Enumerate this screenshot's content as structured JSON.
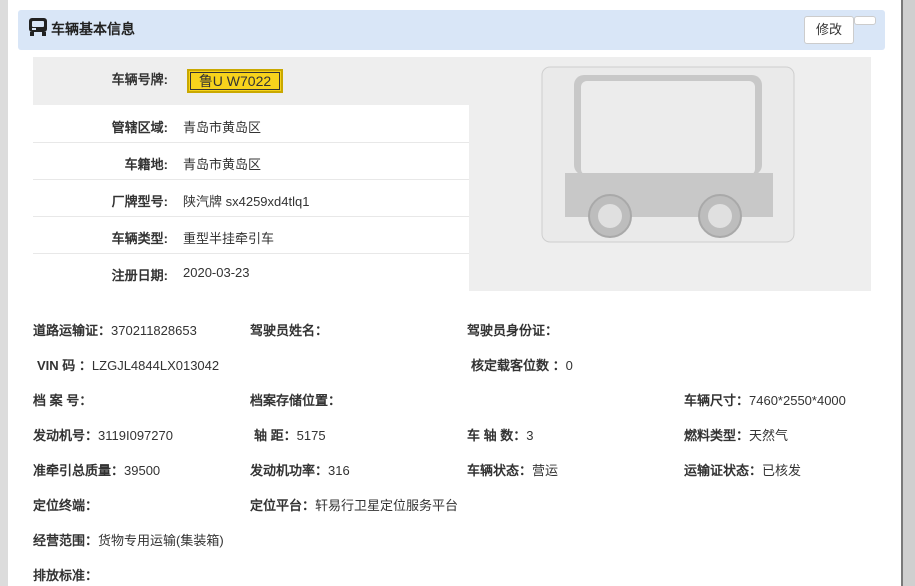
{
  "header": {
    "title": "车辆基本信息",
    "edit_button": "修改",
    "icon": "vehicle-icon"
  },
  "plate": {
    "label": "车辆号牌:",
    "value": "鲁U W7022",
    "color": "#f7d31c"
  },
  "basic_rows": [
    {
      "label": "管辖区域:",
      "value": "青岛市黄岛区"
    },
    {
      "label": "车籍地:",
      "value": "青岛市黄岛区"
    },
    {
      "label": "厂牌型号:",
      "value": "陕汽牌 sx4259xd4tlq1"
    },
    {
      "label": "车辆类型:",
      "value": "重型半挂牵引车"
    },
    {
      "label": "注册日期:",
      "value": "2020-03-23"
    }
  ],
  "details": {
    "transport_cert": {
      "label": "道路运输证：",
      "value": "370211828653"
    },
    "driver_name": {
      "label": "驾驶员姓名：",
      "value": ""
    },
    "driver_id": {
      "label": "驾驶员身份证：",
      "value": ""
    },
    "vin": {
      "label": "VIN 码 ：",
      "value": "LZGJL4844LX013042"
    },
    "seats": {
      "label": "核定载客位数 ：",
      "value": "0"
    },
    "archive_no": {
      "label": "档 案 号：",
      "value": ""
    },
    "archive_loc": {
      "label": "档案存储位置：",
      "value": ""
    },
    "size": {
      "label": "车辆尺寸：",
      "value": "7460*2550*4000"
    },
    "engine_no": {
      "label": "发动机号：",
      "value": "3119I097270"
    },
    "wheelbase": {
      "label": "轴 距：",
      "value": "5175"
    },
    "axles": {
      "label": "车 轴 数：",
      "value": "3"
    },
    "fuel": {
      "label": "燃料类型：",
      "value": "天然气"
    },
    "towing_mass": {
      "label": "准牵引总质量：",
      "value": "39500"
    },
    "engine_power": {
      "label": "发动机功率：",
      "value": "316"
    },
    "vehicle_status": {
      "label": "车辆状态：",
      "value": "营运"
    },
    "transport_status": {
      "label": "运输证状态：",
      "value": "已核发"
    },
    "terminal": {
      "label": "定位终端：",
      "value": ""
    },
    "platform": {
      "label": "定位平台：",
      "value": "轩易行卫星定位服务平台"
    },
    "scope": {
      "label": "经营范围：",
      "value": "货物专用运输(集装箱)"
    },
    "emission": {
      "label": "排放标准：",
      "value": ""
    }
  }
}
